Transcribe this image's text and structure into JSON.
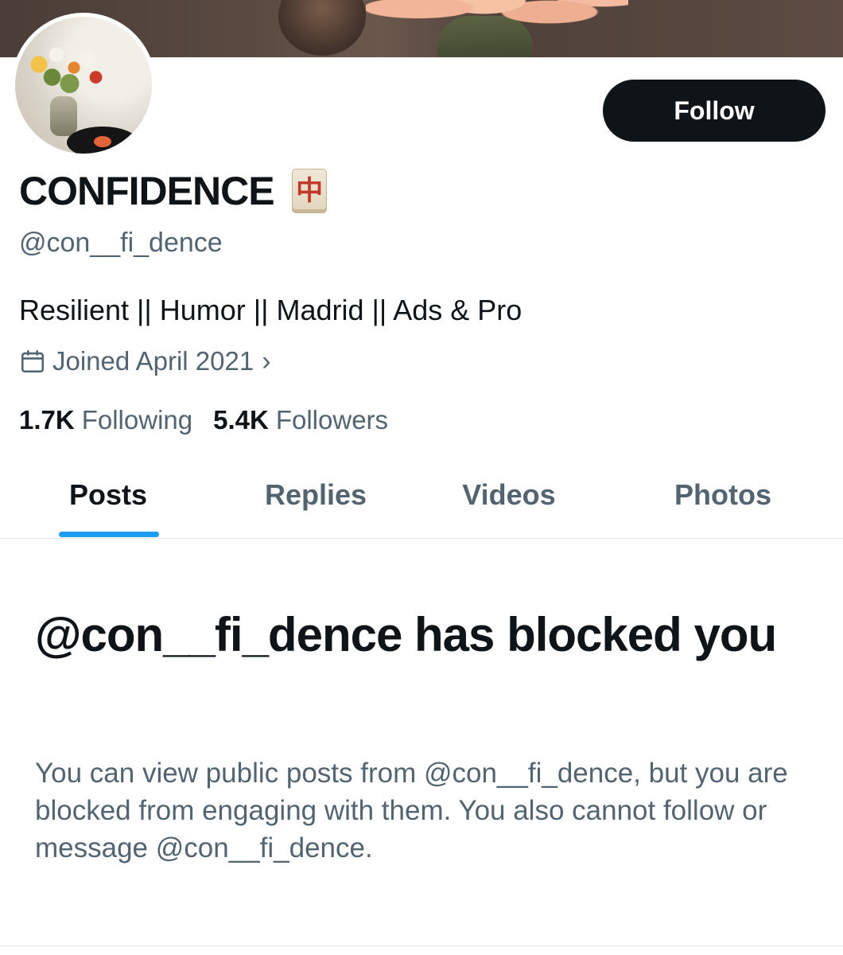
{
  "profile": {
    "display_name": "CONFIDENCE",
    "name_emoji_icon": "mahjong-red-dragon-icon",
    "name_emoji_glyph": "中",
    "handle": "@con__fi_dence",
    "bio": "Resilient || Humor || Madrid || Ads & Pro",
    "joined": "Joined April 2021",
    "follow_label": "Follow"
  },
  "stats": {
    "following_count": "1.7K",
    "following_label": "Following",
    "followers_count": "5.4K",
    "followers_label": "Followers"
  },
  "tabs": [
    {
      "label": "Posts",
      "active": true
    },
    {
      "label": "Replies",
      "active": false
    },
    {
      "label": "Videos",
      "active": false
    },
    {
      "label": "Photos",
      "active": false
    }
  ],
  "blocked": {
    "title": "@con__fi_dence has blocked you",
    "message": "You can view public posts from @con__fi_dence, but you are blocked from engaging with them. You also cannot follow or message @con__fi_dence."
  },
  "colors": {
    "accent": "#1d9bf0",
    "text_primary": "#0f1419",
    "text_secondary": "#536471",
    "button_bg": "#0f1419"
  }
}
